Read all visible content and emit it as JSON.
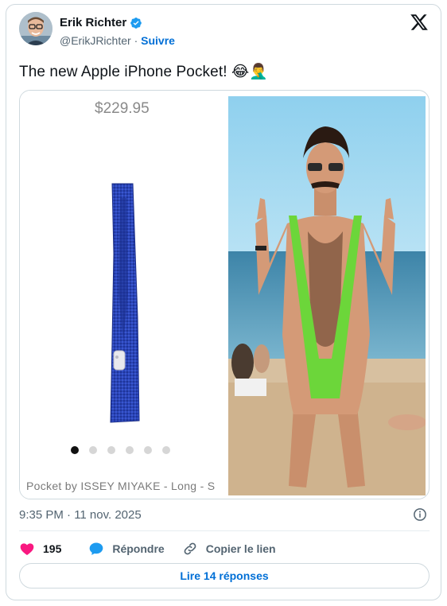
{
  "author": {
    "name": "Erik Richter",
    "handle": "@ErikJRichter",
    "separator": "·",
    "follow_label": "Suivre"
  },
  "tweet": {
    "text": "The new Apple iPhone Pocket! 😂🤦‍♂️"
  },
  "media": {
    "left_image": {
      "price": "$229.95",
      "caption": "Pocket by ISSEY MIYAKE - Long - S",
      "carousel_dots": 6,
      "active_dot": 0
    }
  },
  "meta": {
    "timestamp": "9:35 PM · 11 nov. 2025"
  },
  "actions": {
    "like_count": "195",
    "reply_label": "Répondre",
    "copy_label": "Copier le lien"
  },
  "footer": {
    "read_replies_label": "Lire 14 réponses"
  },
  "colors": {
    "like": "#f91880",
    "link": "#006fd6",
    "verified": "#1d9bf0",
    "muted": "#536471"
  }
}
